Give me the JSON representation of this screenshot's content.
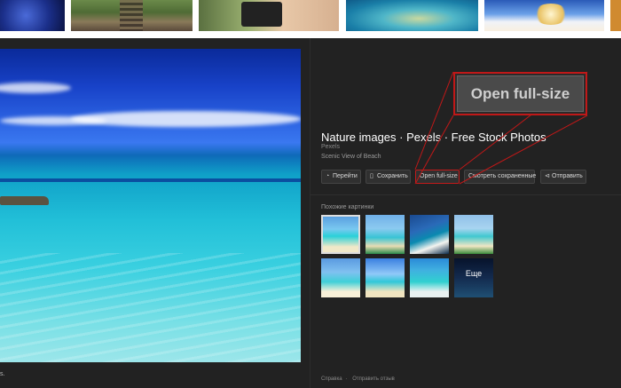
{
  "thumbnail_strip": {
    "thumbnails": [
      "blue-flower",
      "railway-tracks",
      "phone-in-hand",
      "aerial-lagoon",
      "sky-and-snow",
      "orange-edge"
    ]
  },
  "viewer": {
    "title": "Nature images · Pexels · Free Stock Photos",
    "source": "Pexels",
    "subtitle": "Scenic View of Beach",
    "left_caption": "s.",
    "buttons": {
      "visit": "Перейти",
      "save": "Сохранить",
      "open_full_size": "Open full-size",
      "view_saved": "Смотреть сохраненные",
      "share": "Отправить"
    },
    "icons": {
      "visit": "globe-icon",
      "save": "bookmark-icon",
      "share": "share-icon"
    },
    "related": {
      "label": "Похожие картинки",
      "more_label": "Еще"
    },
    "footer": {
      "help": "Справка",
      "feedback": "Отправить отзыв"
    }
  },
  "callout": {
    "label": "Open full-size",
    "border_color": "#c01818"
  },
  "colors": {
    "panel_background": "#222222",
    "highlight": "#c41a1a"
  }
}
